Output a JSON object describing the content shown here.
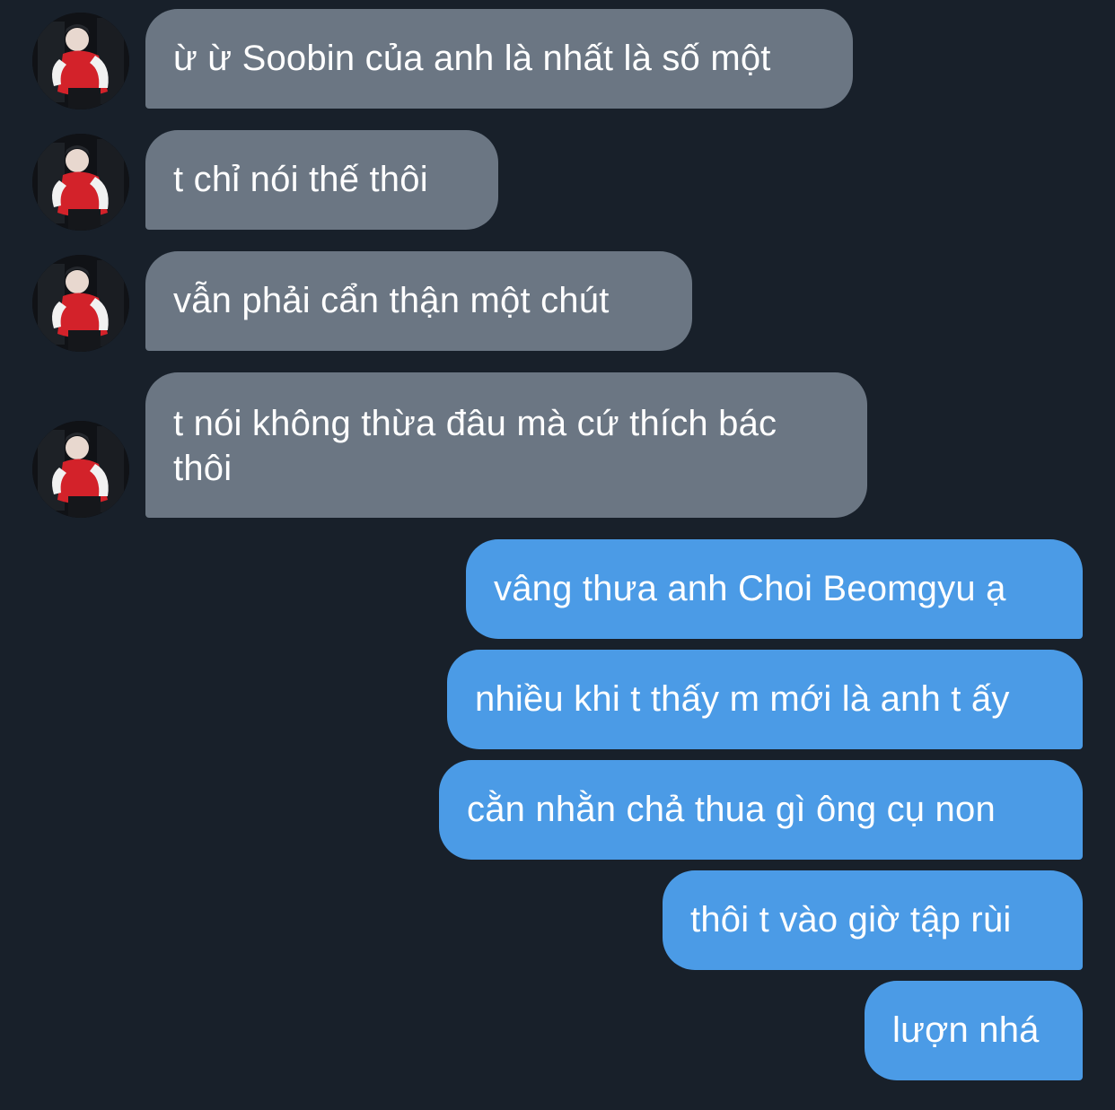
{
  "contact": {
    "avatar_icon": "contact-avatar-photo"
  },
  "incoming": [
    {
      "text": "ừ ừ Soobin của anh là nhất là số một"
    },
    {
      "text": "t chỉ nói thế thôi"
    },
    {
      "text": "vẫn phải cẩn thận một chút"
    },
    {
      "text": "t nói không thừa đâu mà cứ thích bác thôi"
    }
  ],
  "outgoing": [
    {
      "text": "vâng thưa anh Choi Beomgyu ạ"
    },
    {
      "text": "nhiều khi t thấy m mới là anh t ấy"
    },
    {
      "text": "cằn nhằn chả thua gì ông cụ non"
    },
    {
      "text": "thôi t vào giờ tập rùi"
    },
    {
      "text": "lượn nhá"
    }
  ],
  "colors": {
    "background": "#18202a",
    "incoming_bubble": "#6b7683",
    "outgoing_bubble": "#4b9be6",
    "text": "#ffffff"
  }
}
